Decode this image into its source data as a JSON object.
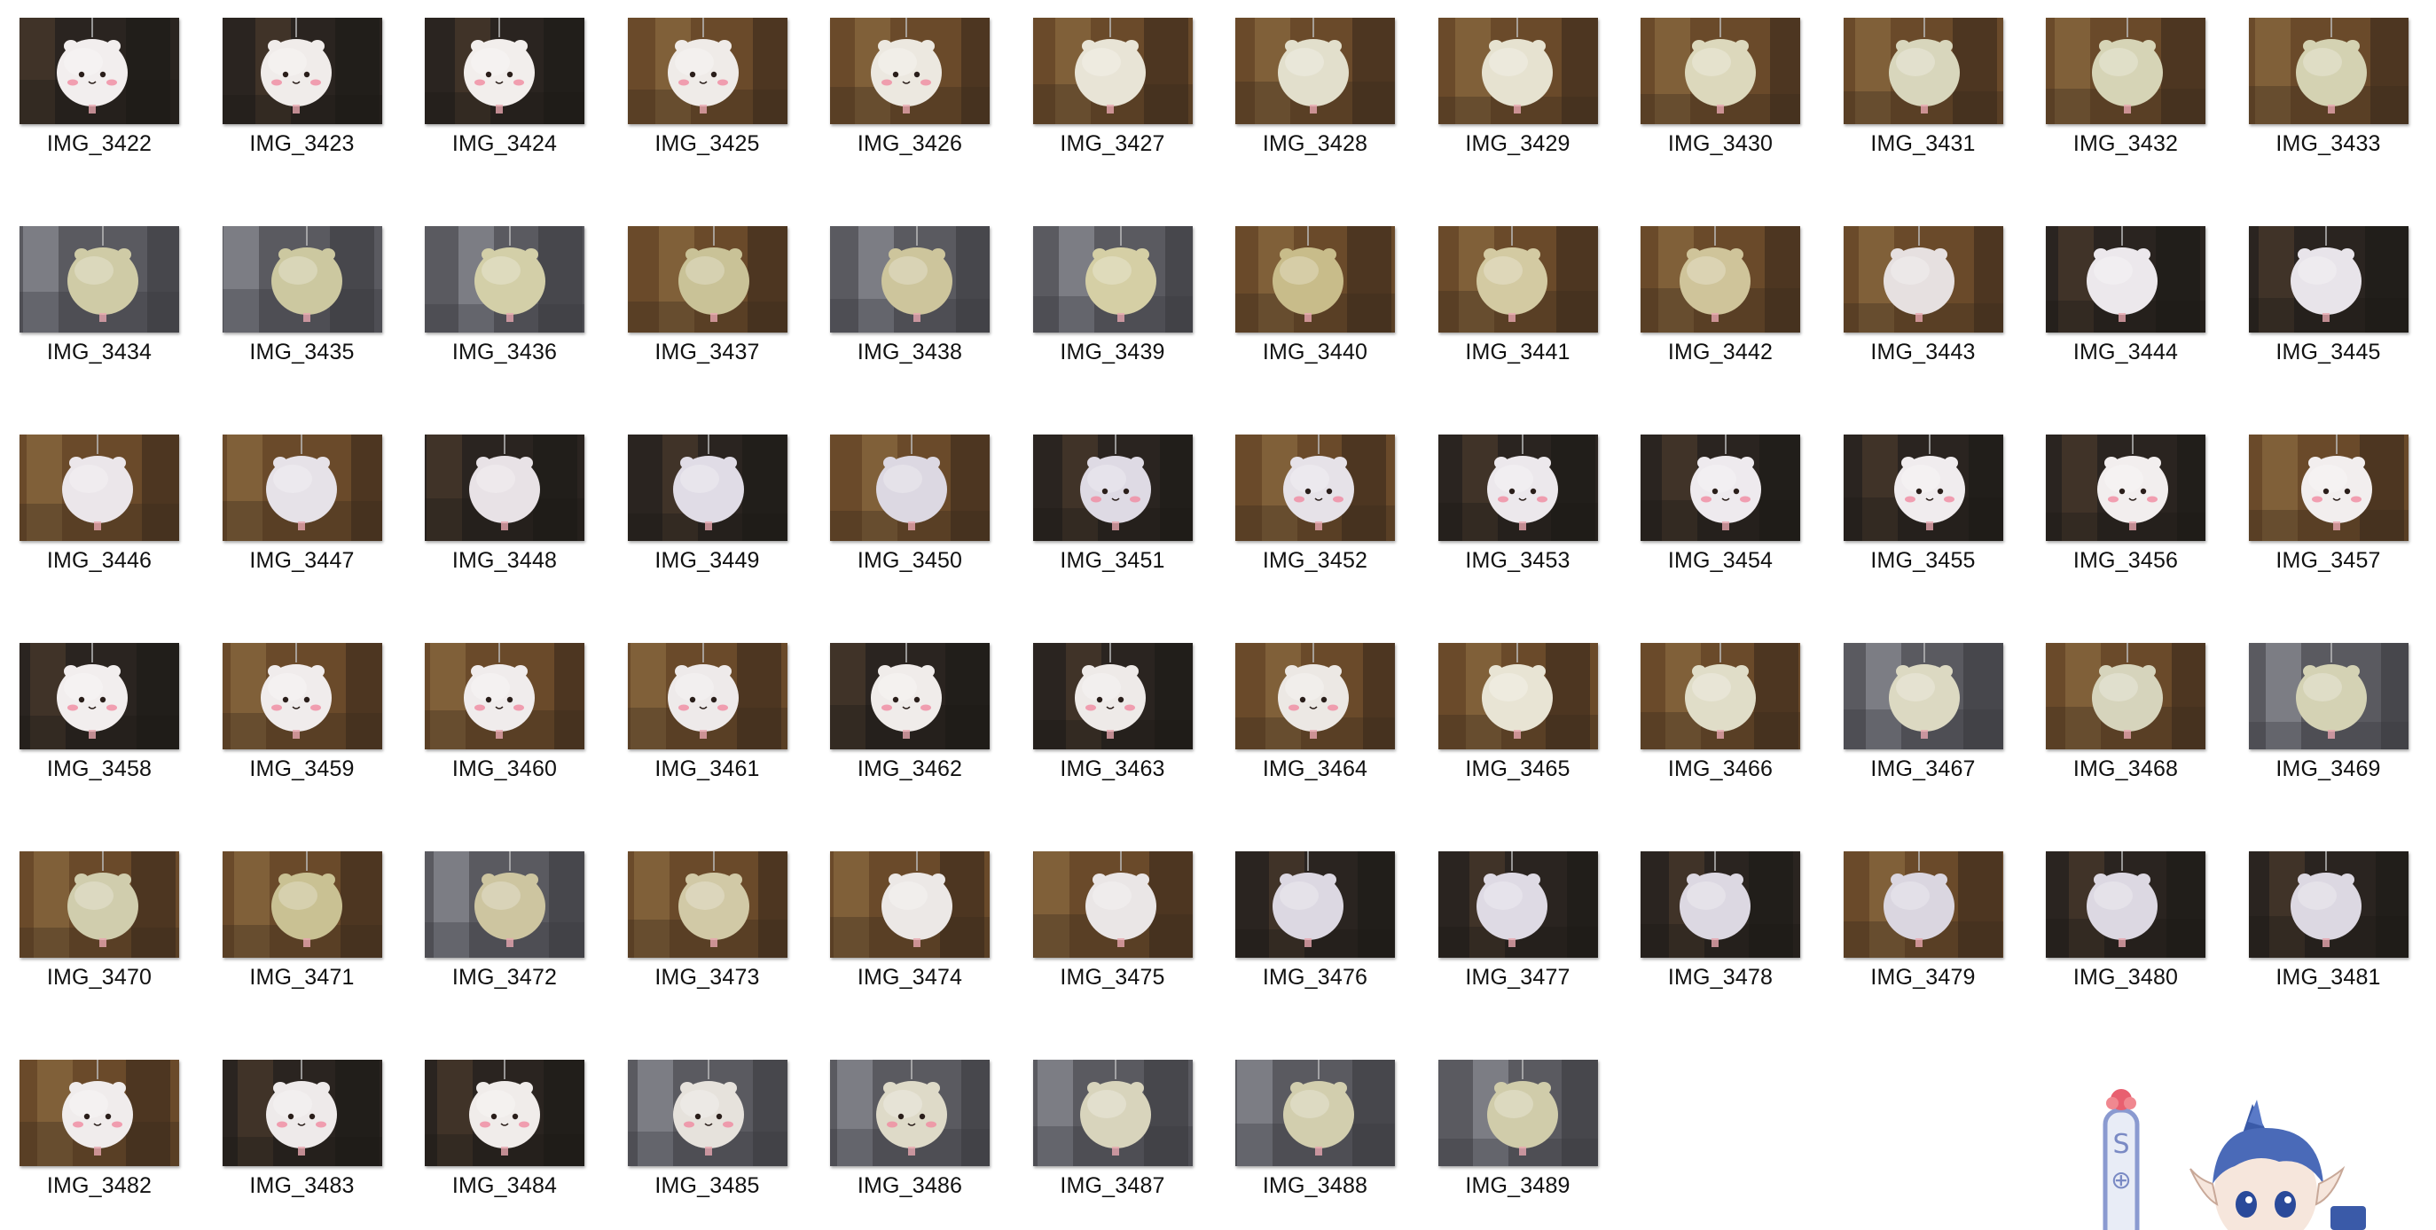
{
  "gallery": {
    "files": [
      {
        "name": "IMG_3422",
        "scene": "dark",
        "face": true,
        "tint": "#f2eeee"
      },
      {
        "name": "IMG_3423",
        "scene": "dark",
        "face": true,
        "tint": "#f0ecea"
      },
      {
        "name": "IMG_3424",
        "scene": "dark",
        "face": true,
        "tint": "#f2eeec"
      },
      {
        "name": "IMG_3425",
        "scene": "warm",
        "face": true,
        "tint": "#efebe8"
      },
      {
        "name": "IMG_3426",
        "scene": "warm",
        "face": true,
        "tint": "#ece8e0"
      },
      {
        "name": "IMG_3427",
        "scene": "warm",
        "face": false,
        "tint": "#e8e4d6"
      },
      {
        "name": "IMG_3428",
        "scene": "warm",
        "face": false,
        "tint": "#e2dfcc"
      },
      {
        "name": "IMG_3429",
        "scene": "warm",
        "face": false,
        "tint": "#e6e2d0"
      },
      {
        "name": "IMG_3430",
        "scene": "warm",
        "face": false,
        "tint": "#dcd8bc"
      },
      {
        "name": "IMG_3431",
        "scene": "warm",
        "face": false,
        "tint": "#d8d6bc"
      },
      {
        "name": "IMG_3432",
        "scene": "warm",
        "face": false,
        "tint": "#d6d4b6"
      },
      {
        "name": "IMG_3433",
        "scene": "warm",
        "face": false,
        "tint": "#d4d2b2"
      },
      {
        "name": "IMG_3434",
        "scene": "cool",
        "face": false,
        "tint": "#cfcba6"
      },
      {
        "name": "IMG_3435",
        "scene": "cool",
        "face": false,
        "tint": "#ccc8a0"
      },
      {
        "name": "IMG_3436",
        "scene": "cool",
        "face": false,
        "tint": "#d3cfa8"
      },
      {
        "name": "IMG_3437",
        "scene": "warm",
        "face": false,
        "tint": "#c9c297"
      },
      {
        "name": "IMG_3438",
        "scene": "cool",
        "face": false,
        "tint": "#cdc59c"
      },
      {
        "name": "IMG_3439",
        "scene": "cool",
        "face": false,
        "tint": "#d5cfa5"
      },
      {
        "name": "IMG_3440",
        "scene": "warm",
        "face": false,
        "tint": "#c8bc8a"
      },
      {
        "name": "IMG_3441",
        "scene": "warm",
        "face": false,
        "tint": "#d3caa2"
      },
      {
        "name": "IMG_3442",
        "scene": "warm",
        "face": false,
        "tint": "#cfc49a"
      },
      {
        "name": "IMG_3443",
        "scene": "warm",
        "face": false,
        "tint": "#e6e0e0"
      },
      {
        "name": "IMG_3444",
        "scene": "dark",
        "face": false,
        "tint": "#ece8ec"
      },
      {
        "name": "IMG_3445",
        "scene": "dark",
        "face": false,
        "tint": "#e8e4ea"
      },
      {
        "name": "IMG_3446",
        "scene": "warm",
        "face": false,
        "tint": "#ebe6ea"
      },
      {
        "name": "IMG_3447",
        "scene": "warm",
        "face": false,
        "tint": "#e6e2e8"
      },
      {
        "name": "IMG_3448",
        "scene": "dark",
        "face": false,
        "tint": "#e8e2e6"
      },
      {
        "name": "IMG_3449",
        "scene": "dark",
        "face": false,
        "tint": "#e0dce6"
      },
      {
        "name": "IMG_3450",
        "scene": "warm",
        "face": false,
        "tint": "#dcd8e2"
      },
      {
        "name": "IMG_3451",
        "scene": "dark",
        "face": true,
        "tint": "#dedae4"
      },
      {
        "name": "IMG_3452",
        "scene": "warm",
        "face": true,
        "tint": "#e6e2e8"
      },
      {
        "name": "IMG_3453",
        "scene": "dark",
        "face": true,
        "tint": "#ece8ec"
      },
      {
        "name": "IMG_3454",
        "scene": "dark",
        "face": true,
        "tint": "#eeeaee"
      },
      {
        "name": "IMG_3455",
        "scene": "dark",
        "face": true,
        "tint": "#f0ecee"
      },
      {
        "name": "IMG_3456",
        "scene": "dark",
        "face": true,
        "tint": "#f2eeee"
      },
      {
        "name": "IMG_3457",
        "scene": "warm",
        "face": true,
        "tint": "#f2eeee"
      },
      {
        "name": "IMG_3458",
        "scene": "dark",
        "face": true,
        "tint": "#f2eeee"
      },
      {
        "name": "IMG_3459",
        "scene": "warm",
        "face": true,
        "tint": "#f0ecec"
      },
      {
        "name": "IMG_3460",
        "scene": "warm",
        "face": true,
        "tint": "#f0ecec"
      },
      {
        "name": "IMG_3461",
        "scene": "warm",
        "face": true,
        "tint": "#eeeaea"
      },
      {
        "name": "IMG_3462",
        "scene": "dark",
        "face": true,
        "tint": "#f0ecea"
      },
      {
        "name": "IMG_3463",
        "scene": "dark",
        "face": true,
        "tint": "#eeeae8"
      },
      {
        "name": "IMG_3464",
        "scene": "warm",
        "face": true,
        "tint": "#ece8e4"
      },
      {
        "name": "IMG_3465",
        "scene": "warm",
        "face": false,
        "tint": "#e8e4d4"
      },
      {
        "name": "IMG_3466",
        "scene": "warm",
        "face": false,
        "tint": "#e0ddc8"
      },
      {
        "name": "IMG_3467",
        "scene": "cool",
        "face": false,
        "tint": "#dcd9c2"
      },
      {
        "name": "IMG_3468",
        "scene": "warm",
        "face": false,
        "tint": "#d6d4bc"
      },
      {
        "name": "IMG_3469",
        "scene": "cool",
        "face": false,
        "tint": "#d4d2b4"
      },
      {
        "name": "IMG_3470",
        "scene": "warm",
        "face": false,
        "tint": "#d0cdad"
      },
      {
        "name": "IMG_3471",
        "scene": "warm",
        "face": false,
        "tint": "#c9c193"
      },
      {
        "name": "IMG_3472",
        "scene": "cool",
        "face": false,
        "tint": "#cdc5a0"
      },
      {
        "name": "IMG_3473",
        "scene": "warm",
        "face": false,
        "tint": "#d1c9a6"
      },
      {
        "name": "IMG_3474",
        "scene": "warm",
        "face": false,
        "tint": "#ece8e6"
      },
      {
        "name": "IMG_3475",
        "scene": "warm",
        "face": false,
        "tint": "#eae6e6"
      },
      {
        "name": "IMG_3476",
        "scene": "dark",
        "face": false,
        "tint": "#dcd8e2"
      },
      {
        "name": "IMG_3477",
        "scene": "dark",
        "face": false,
        "tint": "#dedae4"
      },
      {
        "name": "IMG_3478",
        "scene": "dark",
        "face": false,
        "tint": "#dcd8e2"
      },
      {
        "name": "IMG_3479",
        "scene": "warm",
        "face": false,
        "tint": "#dad6e0"
      },
      {
        "name": "IMG_3480",
        "scene": "dark",
        "face": false,
        "tint": "#dcd8e2"
      },
      {
        "name": "IMG_3481",
        "scene": "dark",
        "face": false,
        "tint": "#dcd8e2"
      },
      {
        "name": "IMG_3482",
        "scene": "warm",
        "face": true,
        "tint": "#f0ecec"
      },
      {
        "name": "IMG_3483",
        "scene": "dark",
        "face": true,
        "tint": "#eeeaea"
      },
      {
        "name": "IMG_3484",
        "scene": "dark",
        "face": true,
        "tint": "#f0ecea"
      },
      {
        "name": "IMG_3485",
        "scene": "cool",
        "face": true,
        "tint": "#e6e2dc"
      },
      {
        "name": "IMG_3486",
        "scene": "cool",
        "face": true,
        "tint": "#dedac8"
      },
      {
        "name": "IMG_3487",
        "scene": "cool",
        "face": false,
        "tint": "#d8d4bc"
      },
      {
        "name": "IMG_3488",
        "scene": "cool",
        "face": false,
        "tint": "#d2ceae"
      },
      {
        "name": "IMG_3489",
        "scene": "cool",
        "face": false,
        "tint": "#d0ccaa"
      }
    ]
  },
  "palette": {
    "dark": [
      "#2a2420",
      "#4a3a2c",
      "#1c1a18"
    ],
    "warm": [
      "#6a4a2a",
      "#8a6a40",
      "#3a2a1c"
    ],
    "cool": [
      "#5a5a60",
      "#8a8c94",
      "#3a3a40"
    ],
    "blush": "#f08aa0",
    "eye": "#2a1e1a"
  },
  "decoration": {
    "sticker_icon": "mascot-sticker-icon",
    "label_icon": "tag-label-icon"
  }
}
